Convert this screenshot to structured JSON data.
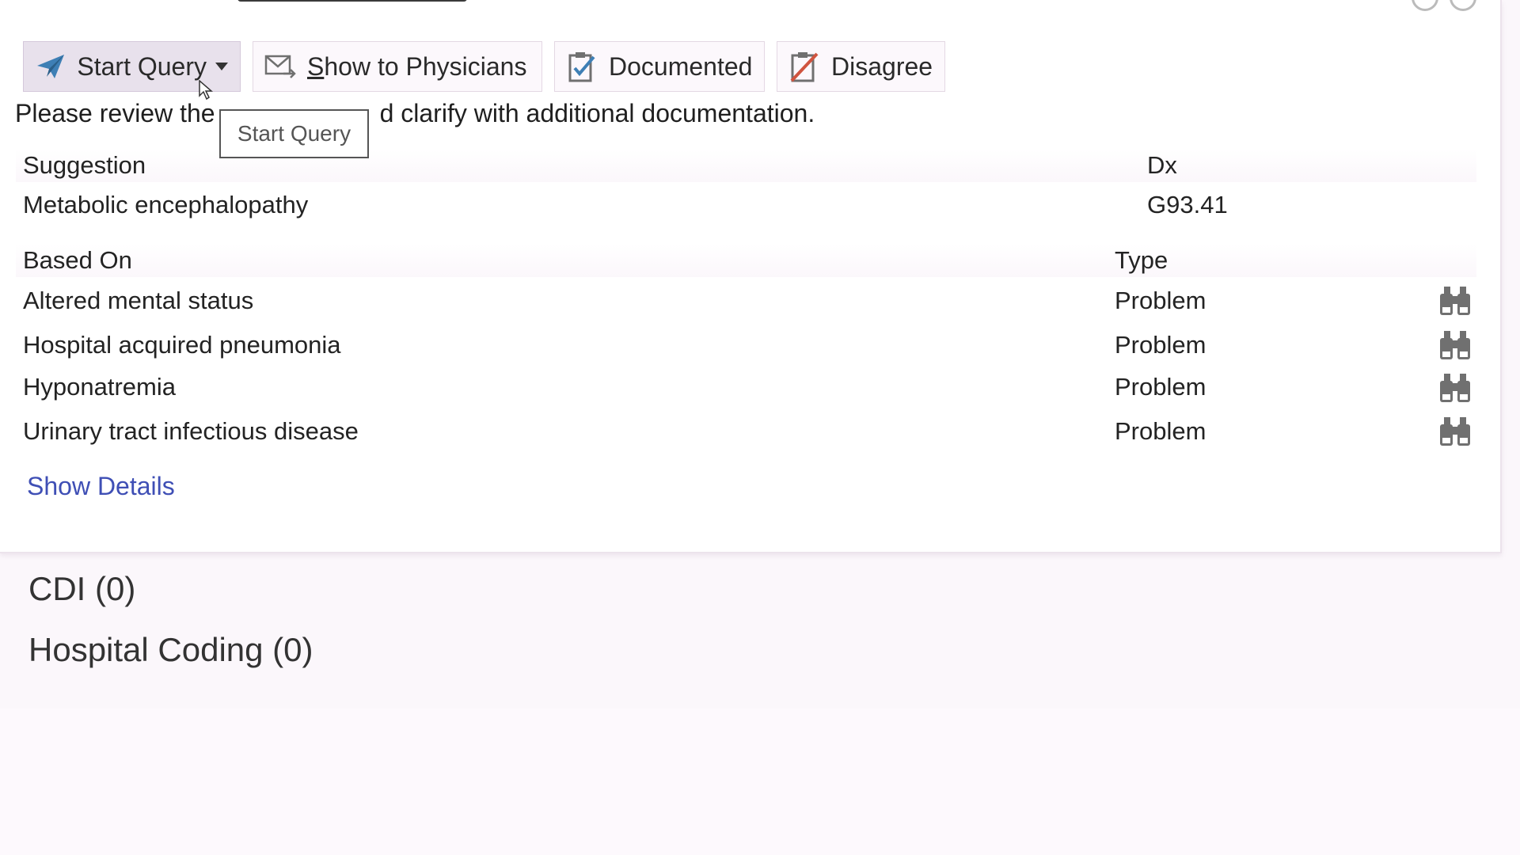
{
  "toolbar": {
    "start_query": "Start Query",
    "show_to_physicians_first": "S",
    "show_to_physicians_rest": "how to Physicians",
    "documented": "Documented",
    "disagree": "Disagree"
  },
  "tooltip": "Start Query",
  "intro": {
    "visible_start": "Please review the",
    "visible_end": "d clarify with additional documentation."
  },
  "suggestions": {
    "col_suggestion": "Suggestion",
    "col_dx": "Dx",
    "rows": [
      {
        "suggestion": "Metabolic encephalopathy",
        "dx": "G93.41"
      }
    ]
  },
  "based_on": {
    "col_based_on": "Based On",
    "col_type": "Type",
    "rows": [
      {
        "label": "Altered mental status",
        "type": "Problem",
        "icon": "binoculars-icon"
      },
      {
        "label": "Hospital acquired pneumonia",
        "type": "Problem",
        "icon": "binoculars-icon"
      },
      {
        "label": "Hyponatremia",
        "type": "Problem",
        "icon": "binoculars-icon"
      },
      {
        "label": "Urinary tract infectious disease",
        "type": "Problem",
        "icon": "binoculars-icon"
      }
    ]
  },
  "show_details": "Show Details",
  "sections": [
    {
      "label": "CDI (0)"
    },
    {
      "label": "Hospital Coding (0)"
    }
  ],
  "colors": {
    "link": "#3f4fb5",
    "primary_button_bg": "#e8e1ec",
    "page_bg": "#fbf7fb",
    "icon_blue": "#3e7fb5",
    "icon_gray": "#707070"
  }
}
